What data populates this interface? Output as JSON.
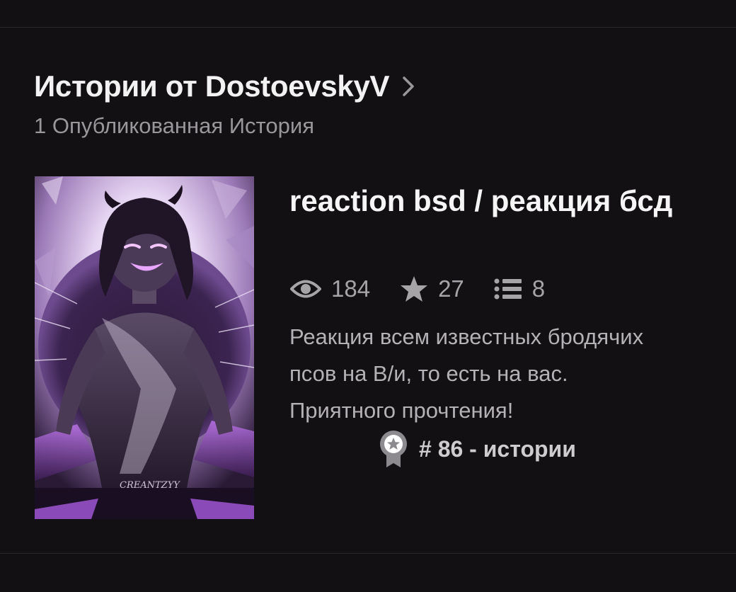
{
  "header": {
    "title": "Истории от DostoevskyV",
    "subtitle": "1 Опубликованная История"
  },
  "story": {
    "title": "reaction bsd / реакция бсд",
    "cover_signature": "CREANTZYY",
    "stats": {
      "reads": "184",
      "votes": "27",
      "parts": "8"
    },
    "description": "Реакция всем известных бродячих псов на В/и, то есть на вас. Приятного прочтения!",
    "rank": "# 86 - истории"
  },
  "icons": {
    "chevron": "chevron-right-icon",
    "reads": "eye-icon",
    "votes": "star-icon",
    "parts": "list-icon",
    "rank": "ribbon-badge-icon"
  },
  "colors": {
    "background": "#121013",
    "title": "#f2f2f2",
    "muted": "#9a979b",
    "accent_purple": "#b46fe0"
  }
}
